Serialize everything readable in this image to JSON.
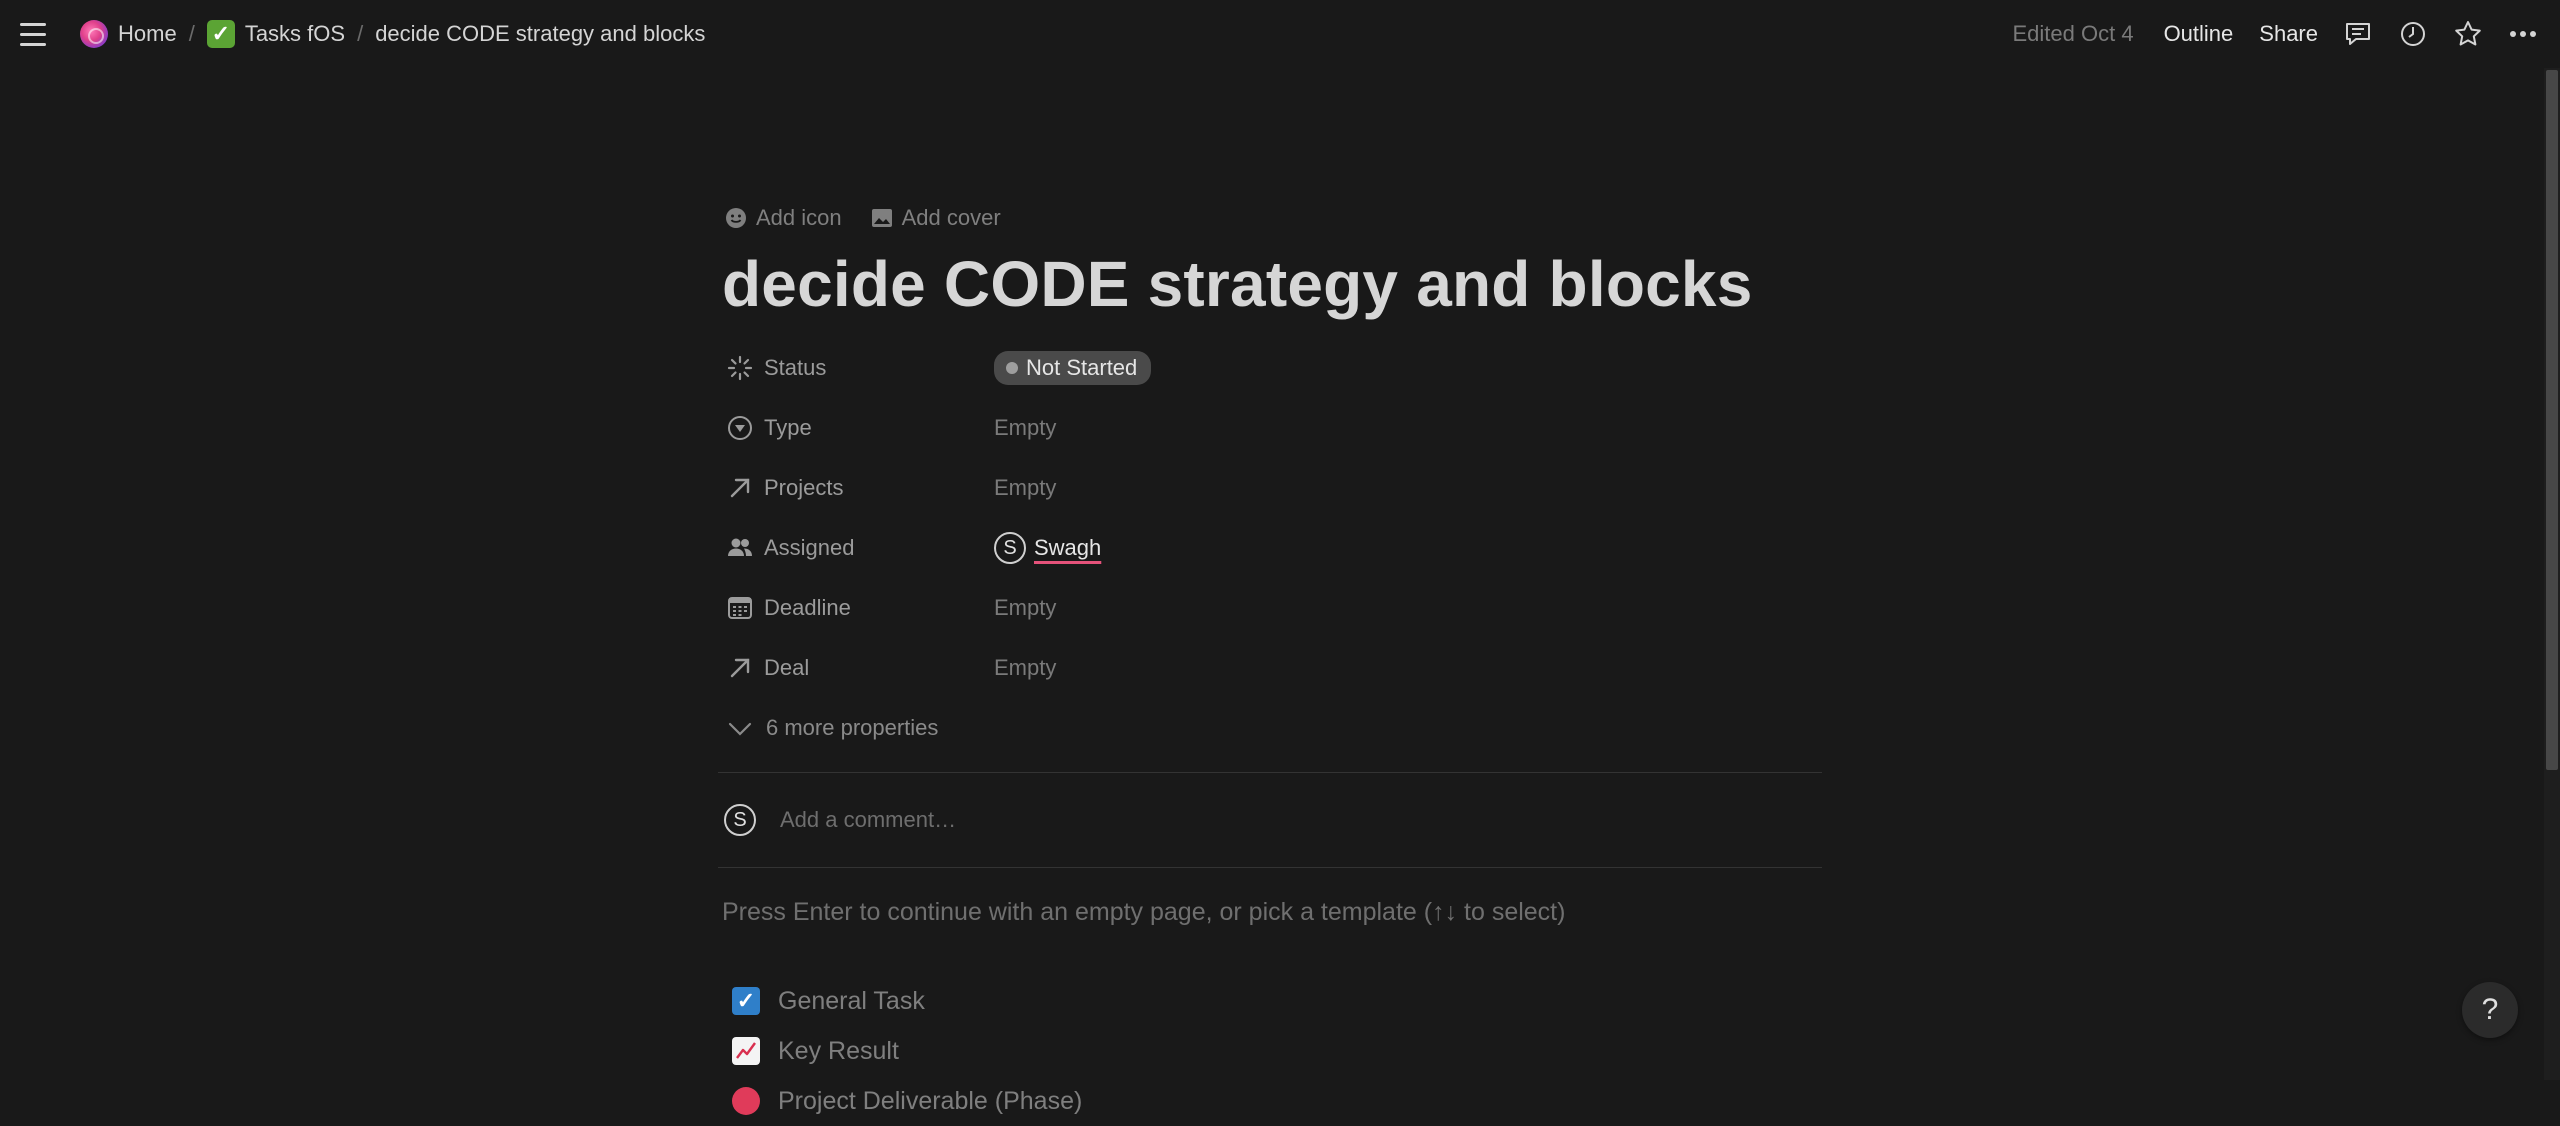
{
  "breadcrumb": {
    "home": "Home",
    "tasks": "Tasks fOS",
    "current": "decide CODE strategy and blocks"
  },
  "topbar": {
    "edited": "Edited Oct 4",
    "outline": "Outline",
    "share": "Share",
    "icons": [
      "comments-icon",
      "history-icon",
      "star-icon",
      "more-icon"
    ]
  },
  "page": {
    "add_icon": "Add icon",
    "add_cover": "Add cover",
    "title": "decide CODE strategy and blocks"
  },
  "properties": [
    {
      "name": "Status",
      "icon": "status-icon",
      "value": "Not Started",
      "kind": "status"
    },
    {
      "name": "Type",
      "icon": "select-icon",
      "value": "Empty",
      "kind": "empty"
    },
    {
      "name": "Projects",
      "icon": "relation-arrow-icon",
      "value": "Empty",
      "kind": "empty"
    },
    {
      "name": "Assigned",
      "icon": "people-icon",
      "value": "Swagh",
      "initial": "S",
      "kind": "person"
    },
    {
      "name": "Deadline",
      "icon": "calendar-icon",
      "value": "Empty",
      "kind": "empty"
    },
    {
      "name": "Deal",
      "icon": "relation-arrow-icon",
      "value": "Empty",
      "kind": "empty"
    }
  ],
  "more_properties": "6 more properties",
  "comment": {
    "avatar_initial": "S",
    "placeholder": "Add a comment…"
  },
  "hint": "Press Enter to continue with an empty page, or pick a template (↑↓ to select)",
  "templates": [
    {
      "label": "General Task",
      "icon": "checkbox-icon"
    },
    {
      "label": "Key Result",
      "icon": "chart-icon"
    },
    {
      "label": "Project Deliverable (Phase)",
      "icon": "red-circle-icon"
    }
  ],
  "help": "?",
  "colors": {
    "background": "#191919",
    "status_pill": "#4a4a4a",
    "assignee_underline": "#e5527a"
  }
}
